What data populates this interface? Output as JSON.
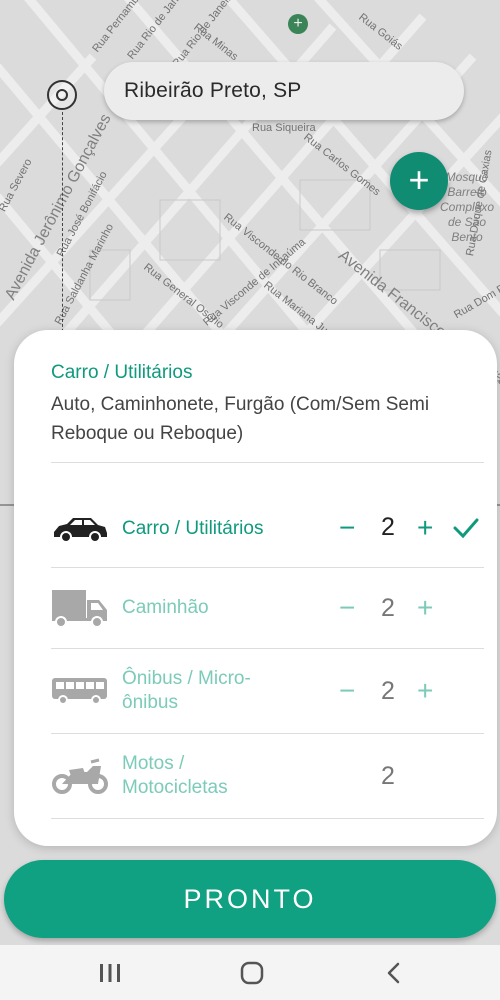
{
  "map": {
    "search_value": "Ribeirão Preto, SP",
    "street_labels": [
      "Rua Pernambuco",
      "Rua Minas",
      "Rua Goiás",
      "Rua Rio de Janeiro",
      "Rua Rio de Janeiro",
      "Rua Carlos Gomes",
      "Rua Siqueira",
      "Avenida Jerônimo Gonçalves",
      "Rua Severo",
      "Rua José Bonifácio",
      "Rua Saldanha Marinho",
      "Rua General Osório",
      "Rua Visconde do Rio Branco",
      "Rua Visconde de Inhaúma",
      "Rua Mariana Junqueira",
      "Avenida Francisco Junqueira",
      "Rua Dom Pedro II",
      "Rua Duque de Caxias"
    ],
    "poi_label": "Mosquê\nBarreto\nComplexo\nde São\nBento"
  },
  "sheet": {
    "title": "Carro / Utilitários",
    "description": "Auto, Caminhonete, Furgão (Com/Sem Semi Reboque ou Reboque)",
    "vehicles": [
      {
        "icon": "car-icon",
        "label": "Carro / Utilitários",
        "quantity": "2",
        "minus": "−",
        "plus": "+",
        "selected": true
      },
      {
        "icon": "truck-icon",
        "label": "Caminhão",
        "quantity": "2",
        "minus": "−",
        "plus": "+",
        "selected": false
      },
      {
        "icon": "bus-icon",
        "label": "Ônibus / Micro-ônibus",
        "quantity": "2",
        "minus": "−",
        "plus": "+",
        "selected": false
      },
      {
        "icon": "motorcycle-icon",
        "label": "Motos / Motocicletas",
        "quantity": "2",
        "selected": false
      }
    ]
  },
  "buttons": {
    "add_stop": "+",
    "done_label": "PRONTO"
  },
  "nav": {
    "recents": "recents-icon",
    "home": "home-icon",
    "back": "back-icon"
  },
  "colors": {
    "accent": "#0f9a7e",
    "accent_light": "#7ccbb8",
    "button": "#0fa181"
  }
}
